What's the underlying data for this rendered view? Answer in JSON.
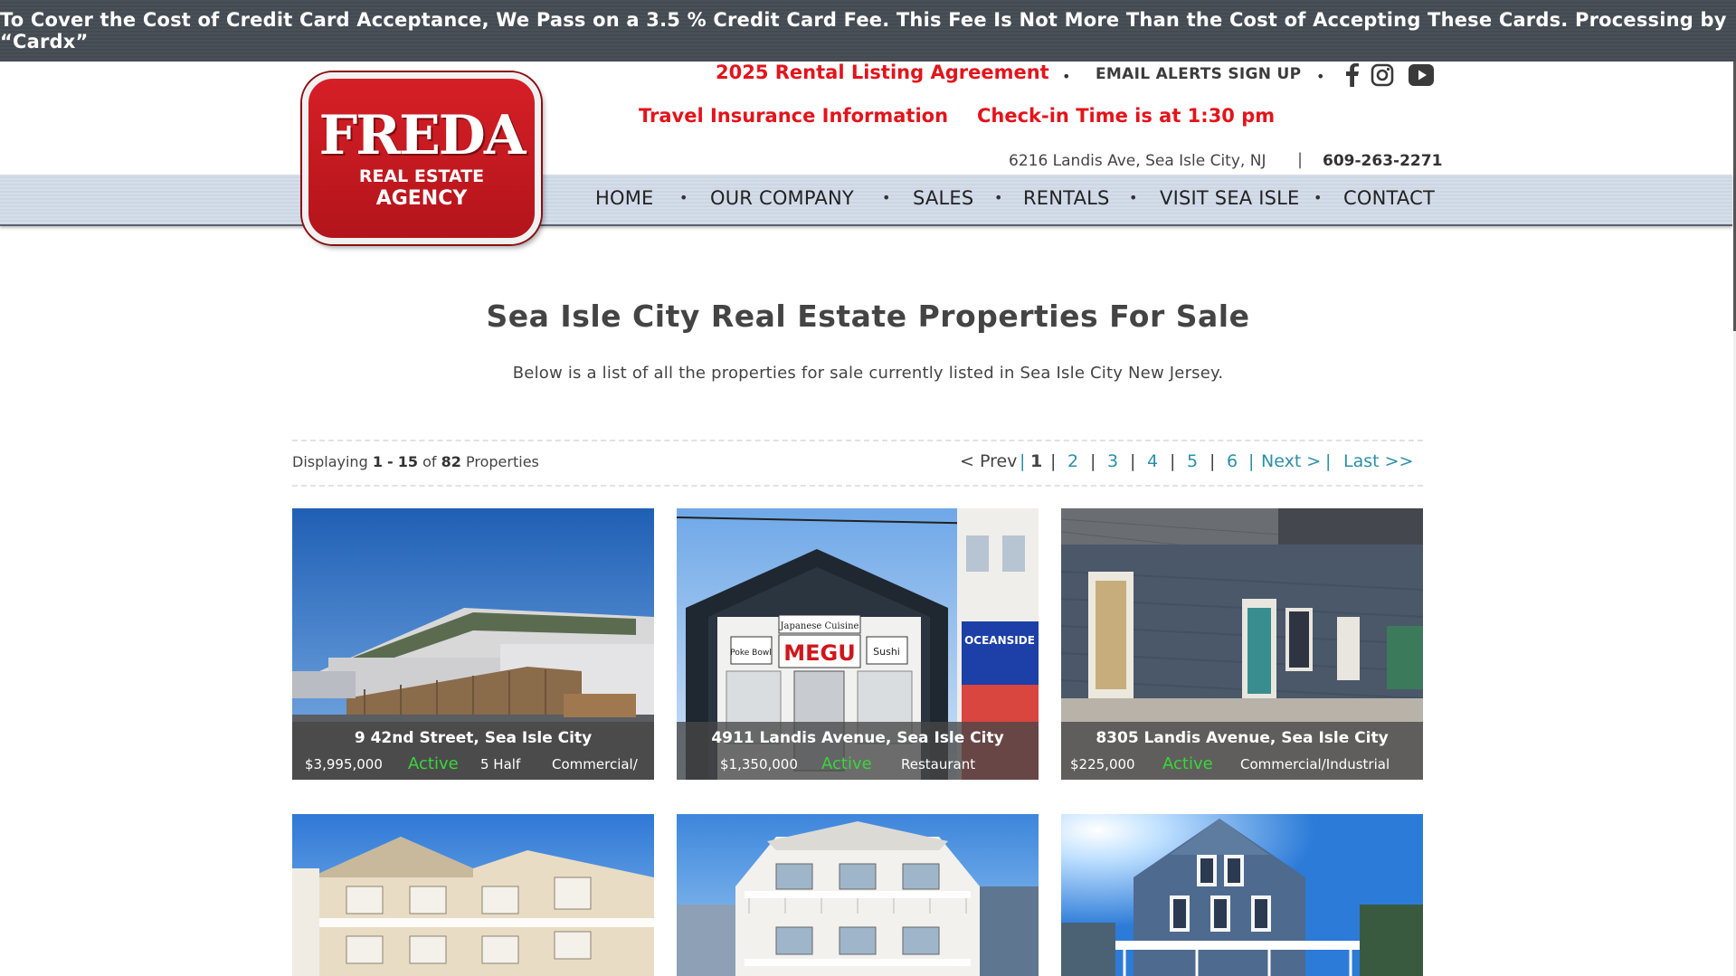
{
  "banner": {
    "text": "To Cover the Cost of Credit Card Acceptance, We Pass on a 3.5 % Credit Card Fee. This Fee Is Not More Than the Cost of Accepting These Cards. Processing by “Cardx”"
  },
  "logo": {
    "main": "FREDA",
    "line1": "REAL ESTATE",
    "line2": "AGENCY"
  },
  "header": {
    "rental_agreement": "2025 Rental Listing Agreement",
    "email_alerts": "EMAIL ALERTS SIGN UP",
    "travel_insurance": "Travel Insurance Information",
    "checkin": "Check-in Time is at 1:30 pm",
    "address": "6216 Landis Ave, Sea Isle City, NJ",
    "separator": "|",
    "phone": "609-263-2271",
    "social_icons": [
      "facebook-icon",
      "instagram-icon",
      "youtube-icon"
    ]
  },
  "nav": [
    "HOME",
    "OUR COMPANY",
    "SALES",
    "RENTALS",
    "VISIT SEA ISLE",
    "CONTACT"
  ],
  "nav_separator": "•",
  "main": {
    "title": "Sea Isle City Real Estate Properties For Sale",
    "subtitle": "Below is a list of all the properties for sale currently listed in Sea Isle City New Jersey."
  },
  "pagination": {
    "displaying_label": "Displaying",
    "range_start": "1",
    "range_dash": "-",
    "range_end": "15",
    "of_label": "of",
    "total": "82",
    "properties_label": "Properties",
    "prev": "< Prev",
    "current": "1",
    "pages": [
      "2",
      "3",
      "4",
      "5",
      "6"
    ],
    "next": "Next >",
    "last": "Last >>",
    "divider": "|"
  },
  "listings": [
    {
      "address": "9 42nd Street, Sea Isle City",
      "price": "$3,995,000",
      "status": "Active",
      "detail": "5 Half",
      "type": "Commercial/"
    },
    {
      "address": "4911 Landis Avenue, Sea Isle City",
      "price": "$1,350,000",
      "status": "Active",
      "detail": "",
      "type": "Restaurant"
    },
    {
      "address": "8305 Landis Avenue, Sea Isle City",
      "price": "$225,000",
      "status": "Active",
      "detail": "",
      "type": "Commercial/Industrial"
    },
    {
      "address": "",
      "price": "",
      "status": "",
      "detail": "",
      "type": ""
    },
    {
      "address": "",
      "price": "",
      "status": "",
      "detail": "",
      "type": ""
    },
    {
      "address": "",
      "price": "",
      "status": "",
      "detail": "",
      "type": ""
    }
  ],
  "storefront_sign": {
    "top": "Japanese Cuisine",
    "name": "MEGU",
    "left": "Poke Bowl",
    "right": "Sushi",
    "neighbor": "OCEANSIDE"
  },
  "colors": {
    "accent_red": "#e3141b",
    "link_teal": "#2d8fa6",
    "status_green": "#3ad63a",
    "banner_bg": "#474d55",
    "nav_bg": "#d2dae7"
  }
}
